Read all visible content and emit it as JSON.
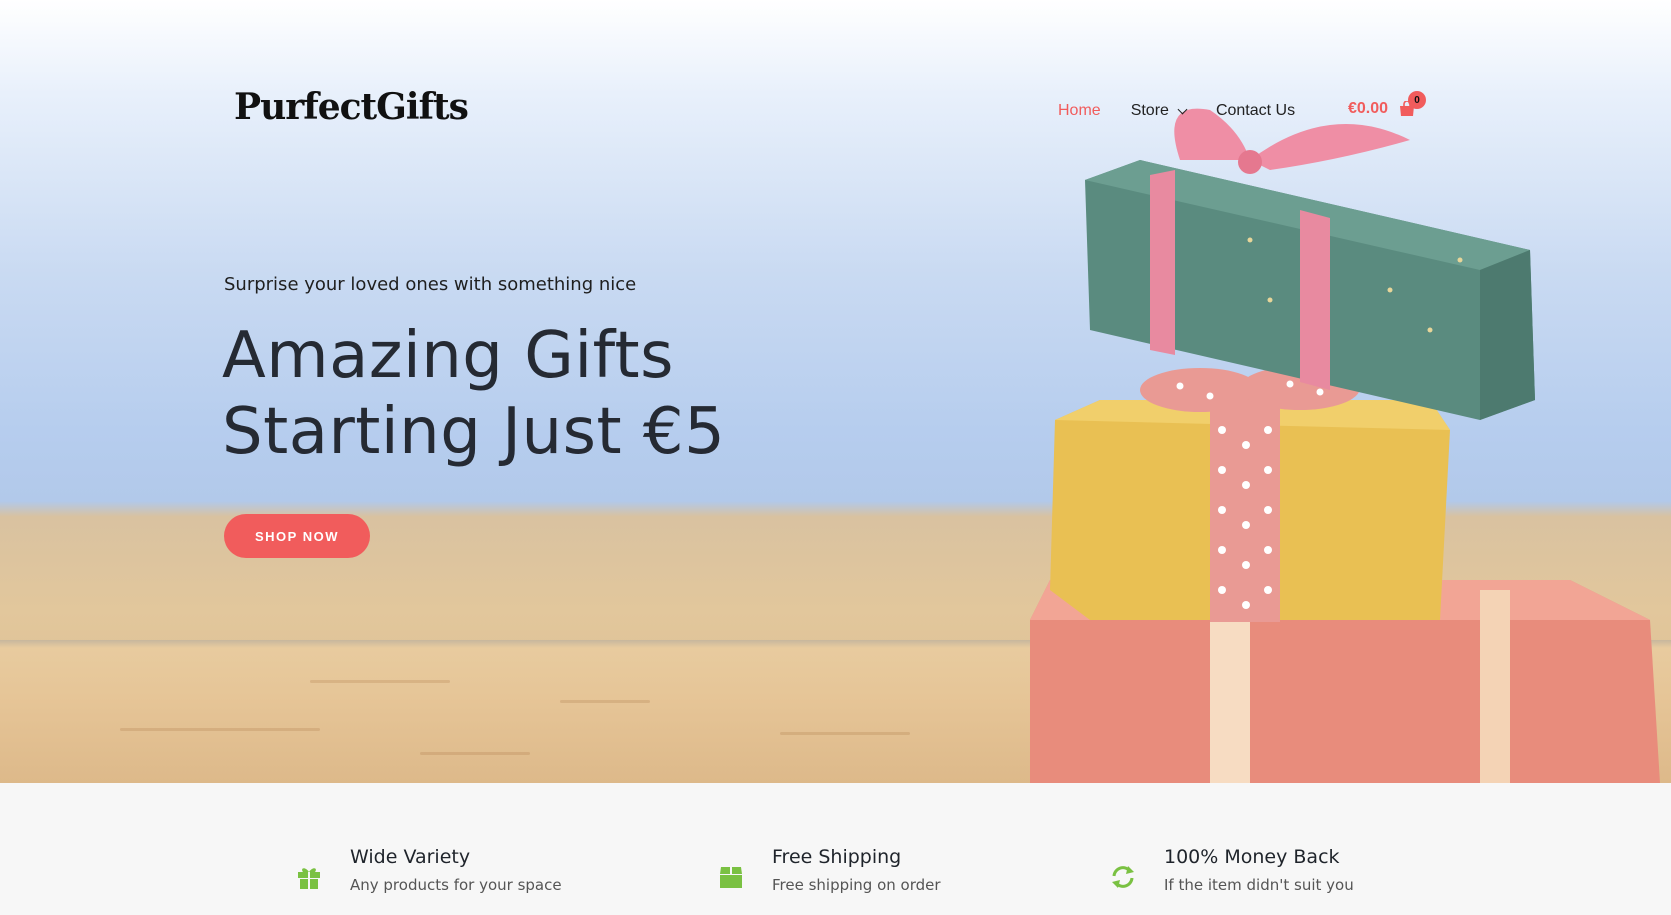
{
  "header": {
    "logo_text": "PurfectGifts",
    "nav": [
      {
        "label": "Home",
        "active": true
      },
      {
        "label": "Store",
        "has_dropdown": true
      },
      {
        "label": "Contact Us"
      }
    ],
    "cart": {
      "amount": "€0.00",
      "count": "0"
    }
  },
  "hero": {
    "tagline": "Surprise your loved ones with something nice",
    "headline_line1": "Amazing Gifts",
    "headline_line2": "Starting Just €5",
    "cta_label": "SHOP NOW"
  },
  "features": [
    {
      "icon": "gift-icon",
      "title": "Wide Variety",
      "desc": "Any products for your space"
    },
    {
      "icon": "box-icon",
      "title": "Free Shipping",
      "desc": "Free shipping on order"
    },
    {
      "icon": "refresh-icon",
      "title": "100% Money Back",
      "desc": "If the item didn't suit you"
    }
  ],
  "colors": {
    "accent": "#f15c5c",
    "feature_icon": "#7ac142",
    "text_dark": "#252a33"
  }
}
